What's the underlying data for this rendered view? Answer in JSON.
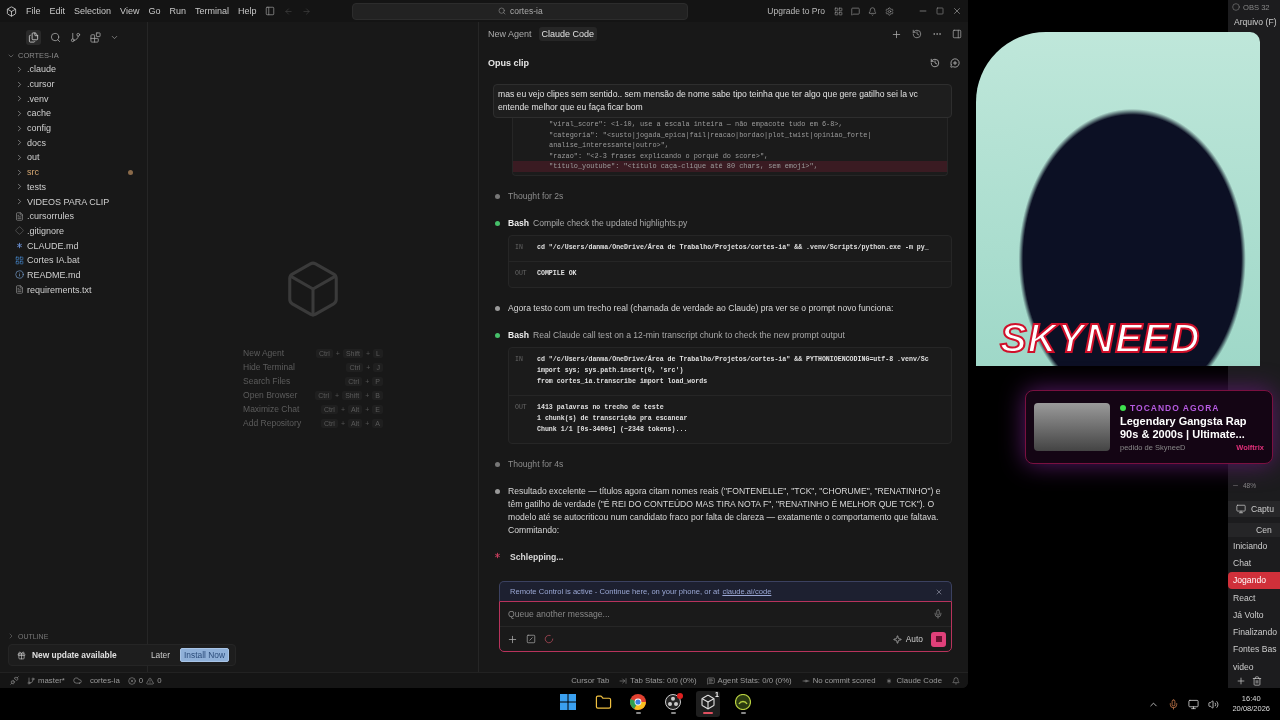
{
  "titlebar": {
    "menu": [
      "File",
      "Edit",
      "Selection",
      "View",
      "Go",
      "Run",
      "Terminal",
      "Help"
    ],
    "search": "cortes-ia",
    "upgrade": "Upgrade to Pro"
  },
  "explorer": {
    "title": "CORTES-IA",
    "items": [
      {
        "name": ".claude",
        "kind": "folder",
        "modified": false
      },
      {
        "name": ".cursor",
        "kind": "folder",
        "modified": false
      },
      {
        "name": ".venv",
        "kind": "folder",
        "modified": false
      },
      {
        "name": "cache",
        "kind": "folder",
        "modified": false
      },
      {
        "name": "config",
        "kind": "folder",
        "modified": false
      },
      {
        "name": "docs",
        "kind": "folder",
        "modified": false
      },
      {
        "name": "out",
        "kind": "folder",
        "modified": false
      },
      {
        "name": "src",
        "kind": "folder",
        "modified": true
      },
      {
        "name": "tests",
        "kind": "folder",
        "modified": false
      },
      {
        "name": "VIDEOS PARA CLIP",
        "kind": "folder",
        "modified": false
      },
      {
        "name": ".cursorrules",
        "kind": "text",
        "modified": false
      },
      {
        "name": ".gitignore",
        "kind": "git",
        "modified": false
      },
      {
        "name": "CLAUDE.md",
        "kind": "claude",
        "modified": false
      },
      {
        "name": "Cortes IA.bat",
        "kind": "bat",
        "modified": false
      },
      {
        "name": "README.md",
        "kind": "info",
        "modified": false
      },
      {
        "name": "requirements.txt",
        "kind": "text",
        "modified": false
      }
    ],
    "outline": "OUTLINE"
  },
  "editor": {
    "joiner": "+",
    "shortcuts": [
      {
        "label": "New Agent",
        "keys": [
          "Ctrl",
          "Shift",
          "L"
        ]
      },
      {
        "label": "Hide Terminal",
        "keys": [
          "Ctrl",
          "J"
        ]
      },
      {
        "label": "Search Files",
        "keys": [
          "Ctrl",
          "P"
        ]
      },
      {
        "label": "Open Browser",
        "keys": [
          "Ctrl",
          "Shift",
          "B"
        ]
      },
      {
        "label": "Maximize Chat",
        "keys": [
          "Ctrl",
          "Alt",
          "E"
        ]
      },
      {
        "label": "Add Repository",
        "keys": [
          "Ctrl",
          "Alt",
          "A"
        ]
      }
    ]
  },
  "update": {
    "text": "New update available",
    "later": "Later",
    "install": "Install Now"
  },
  "chat": {
    "tabs": [
      {
        "label": "New Agent",
        "selected": false
      },
      {
        "label": "Claude Code",
        "selected": true
      }
    ],
    "title": "Opus clip",
    "user_message": "mas eu vejo clipes sem sentido.. sem mensão de nome sabe tipo teinha que ter algo que gere gatilho sei la vc entende melhor que eu faça ficar bom",
    "code_lines": [
      {
        "text": "\"viral_score\": <1-10, use a escala inteira — não empacote tudo em 6-8>,",
        "removed": false
      },
      {
        "text": "\"categoria\": \"<susto|jogada_epica|fail|reacao|bordao|plot_twist|opiniao_forte|",
        "removed": false
      },
      {
        "text": "analise_interessante|outro>\",",
        "removed": false
      },
      {
        "text": "\"razao\": \"<2-3 frases explicando o porquê do score>\",",
        "removed": false
      },
      {
        "text": "\"titulo_youtube\": \"<título caça-clique até 80 chars, sem emoji>\",",
        "removed": true
      }
    ],
    "steps": [
      {
        "kind": "thought",
        "text": "Thought for 2s"
      },
      {
        "kind": "bash",
        "title": "Bash",
        "text": "Compile check the updated highlights.py",
        "io": [
          {
            "label": "IN",
            "lines": [
              "cd \"/c/Users/danma/OneDrive/Área de Trabalho/Projetos/cortes-ia\" && .venv/Scripts/python.exe -m py_"
            ]
          },
          {
            "label": "OUT",
            "lines": [
              "COMPILE OK"
            ]
          }
        ]
      },
      {
        "kind": "text",
        "text": "Agora testo com um trecho real (chamada de verdade ao Claude) pra ver se o prompt novo funciona:"
      },
      {
        "kind": "bash",
        "title": "Bash",
        "text": "Real Claude call test on a 12-min transcript chunk to check the new prompt output",
        "io": [
          {
            "label": "IN",
            "lines": [
              "cd \"/c/Users/danma/OneDrive/Área de Trabalho/Projetos/cortes-ia\" && PYTHONIOENCODING=utf-8 .venv/Sc",
              "import sys; sys.path.insert(0, 'src')",
              "from cortes_ia.transcribe import load_words"
            ]
          },
          {
            "label": "OUT",
            "lines": [
              "1413 palavras no trecho de teste",
              "1 chunk(s) de transcrição pra escanear",
              "Chunk 1/1 [0s-3400s] (~2348 tokens)..."
            ]
          }
        ]
      },
      {
        "kind": "thought",
        "text": "Thought for 4s"
      },
      {
        "kind": "text",
        "text": "Resultado excelente — títulos agora citam nomes reais (\"FONTENELLE\", \"TCK\", \"CHORUME\", \"RENATINHO\") e têm gatilho de verdade (\"É REI DO CONTEÚDO MAS TIRA NOTA F\", \"RENATINHO É MELHOR QUE TCK\"). O modelo até se autocriticou num candidato fraco por falta de clareza — exatamente o comportamento que faltava. Commitando:"
      },
      {
        "kind": "status",
        "text": "Schlepping..."
      }
    ],
    "banner": {
      "text": "Remote Control is active - Continue here, on your phone, or at",
      "link": "claude.ai/code"
    },
    "composer": {
      "placeholder": "Queue another message...",
      "mode": "Auto"
    }
  },
  "status_bar": {
    "branch": "master*",
    "project": "cortes-ia",
    "errors": "0",
    "warnings": "0",
    "cursor_tab": "Cursor Tab",
    "tab_stats": "Tab Stats: 0/0 (0%)",
    "agent_stats": "Agent Stats: 0/0 (0%)",
    "commit": "No commit scored",
    "agent": "Claude Code"
  },
  "overlay": {
    "name": "SKYNEED",
    "now_playing": {
      "label": "TOCANDO AGORA",
      "title": "Legendary Gangsta Rap 90s & 2000s | Ultimate...",
      "requested_by": "pedido de SkyneeD",
      "user": "Wolftrix"
    }
  },
  "obs": {
    "title": "OBS 32",
    "menu": "Arquivo (F)",
    "zoom": "48%",
    "source": "Captu",
    "scenes_header": "Cen",
    "scenes": [
      {
        "name": "Iniciando",
        "selected": false
      },
      {
        "name": "Chat",
        "selected": false
      },
      {
        "name": "Jogando",
        "selected": true
      },
      {
        "name": "React",
        "selected": false
      },
      {
        "name": "Já Volto",
        "selected": false
      },
      {
        "name": "Finalizando",
        "selected": false
      },
      {
        "name": "Fontes Bas",
        "selected": false
      },
      {
        "name": "video",
        "selected": false
      }
    ]
  },
  "taskbar": {
    "apps": [
      {
        "kind": "start",
        "running": false,
        "active": false,
        "alert": false
      },
      {
        "kind": "folder",
        "running": false,
        "active": false,
        "alert": false
      },
      {
        "kind": "chrome",
        "running": true,
        "active": false,
        "alert": false
      },
      {
        "kind": "obs",
        "running": true,
        "active": false,
        "alert": true
      },
      {
        "kind": "cursor",
        "running": true,
        "active": true,
        "alert": false,
        "badge": "1"
      },
      {
        "kind": "app",
        "running": true,
        "active": false,
        "alert": false
      }
    ],
    "time": "16:40",
    "date": "20/08/2026"
  }
}
